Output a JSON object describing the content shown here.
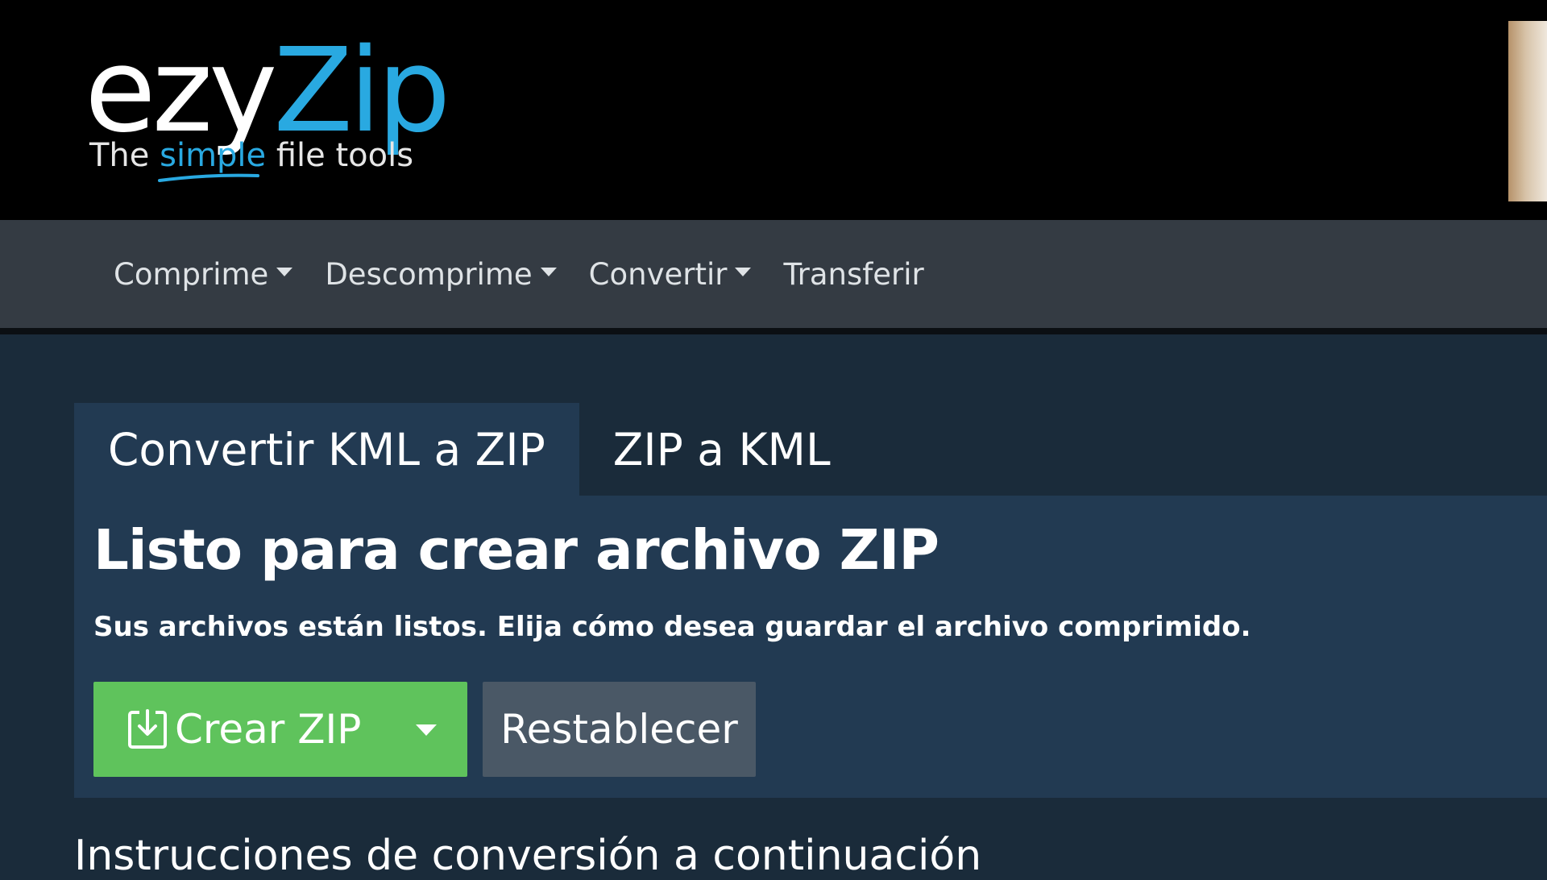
{
  "logo": {
    "text_part1": "ezy",
    "text_part2": "Zip",
    "tagline_pre": "The ",
    "tagline_highlight": "simple",
    "tagline_post": " file tools"
  },
  "nav": {
    "items": [
      {
        "label": "Comprime",
        "has_dropdown": true
      },
      {
        "label": "Descomprime",
        "has_dropdown": true
      },
      {
        "label": "Convertir",
        "has_dropdown": true
      },
      {
        "label": "Transferir",
        "has_dropdown": false
      }
    ]
  },
  "tabs": [
    {
      "label": "Convertir KML a ZIP",
      "active": true
    },
    {
      "label": "ZIP a KML",
      "active": false
    }
  ],
  "panel": {
    "title": "Listo para crear archivo ZIP",
    "subtitle": "Sus archivos están listos. Elija cómo desea guardar el archivo comprimido.",
    "create_button": "Crear ZIP",
    "reset_button": "Restablecer"
  },
  "instructions_heading": "Instrucciones de conversión a continuación",
  "icons": {
    "create_button_icon": "download-icon",
    "dropdown_caret": "chevron-down-icon"
  },
  "colors": {
    "brand_blue": "#29a9e1",
    "create_button_green": "#5fc35c",
    "panel_bg": "#223a52",
    "navbar_bg": "#343b43"
  }
}
